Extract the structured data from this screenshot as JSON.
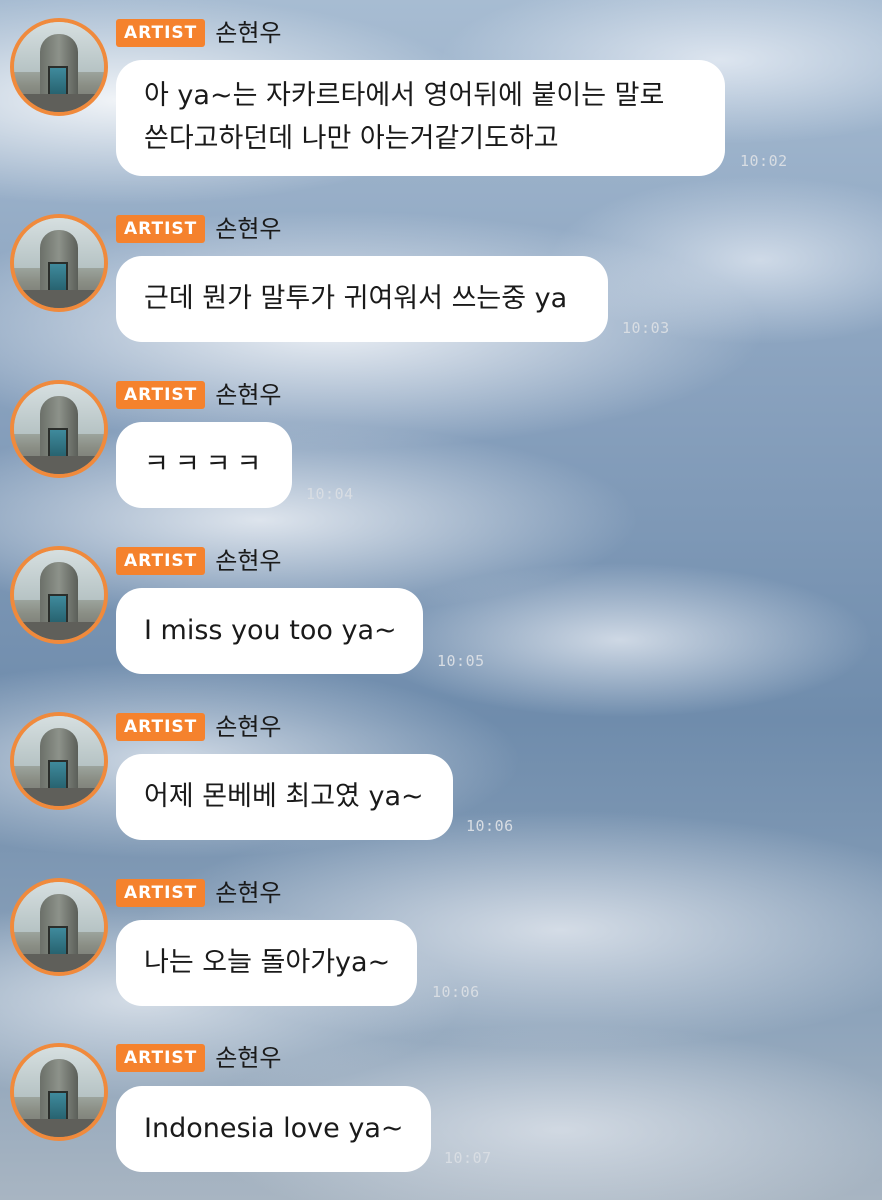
{
  "badge_label": "ARTIST",
  "sender_name": "손현우",
  "colors": {
    "badge": "#f5822d",
    "avatar_ring": "#f08a3c",
    "bubble": "#ffffff"
  },
  "messages": [
    {
      "lines": [
        "아 ya~는 자카르타에서 영어뒤에 붙이는 말로",
        "쓴다고하던데 나만 아는거같기도하고"
      ],
      "time": "10:02"
    },
    {
      "lines": [
        "근데 뭔가 말투가 귀여워서 쓰는중 ya"
      ],
      "time": "10:03"
    },
    {
      "lines": [
        "ㅋㅋㅋㅋ"
      ],
      "time": "10:04"
    },
    {
      "lines": [
        "I miss you too ya~"
      ],
      "time": "10:05"
    },
    {
      "lines": [
        "어제 몬베베 최고였 ya~"
      ],
      "time": "10:06"
    },
    {
      "lines": [
        "나는 오늘 돌아가ya~"
      ],
      "time": "10:06"
    },
    {
      "lines": [
        "Indonesia love ya~"
      ],
      "time": "10:07"
    }
  ]
}
